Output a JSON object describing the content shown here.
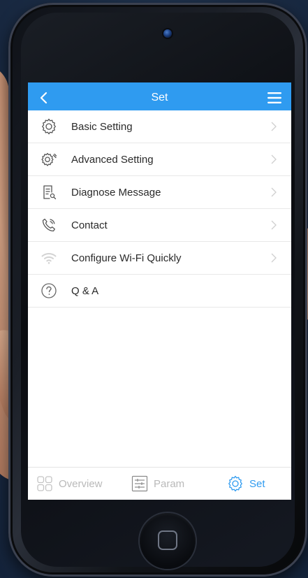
{
  "header": {
    "title": "Set",
    "back_icon": "chevron-left-icon",
    "menu_icon": "hamburger-menu-icon"
  },
  "menu": [
    {
      "label": "Basic Setting",
      "icon": "gear-icon"
    },
    {
      "label": "Advanced Setting",
      "icon": "advanced-gear-icon"
    },
    {
      "label": "Diagnose Message",
      "icon": "document-search-icon"
    },
    {
      "label": "Contact",
      "icon": "phone-icon"
    },
    {
      "label": "Configure Wi-Fi Quickly",
      "icon": "wifi-icon"
    },
    {
      "label": "Q & A",
      "icon": "question-circle-icon"
    }
  ],
  "tabs": [
    {
      "label": "Overview",
      "icon": "grid-icon",
      "active": false
    },
    {
      "label": "Param",
      "icon": "sliders-icon",
      "active": false
    },
    {
      "label": "Set",
      "icon": "gear-icon",
      "active": true
    }
  ],
  "colors": {
    "accent": "#2f9bf0",
    "inactive": "#b9b9b9",
    "text": "#2a2a2a"
  }
}
